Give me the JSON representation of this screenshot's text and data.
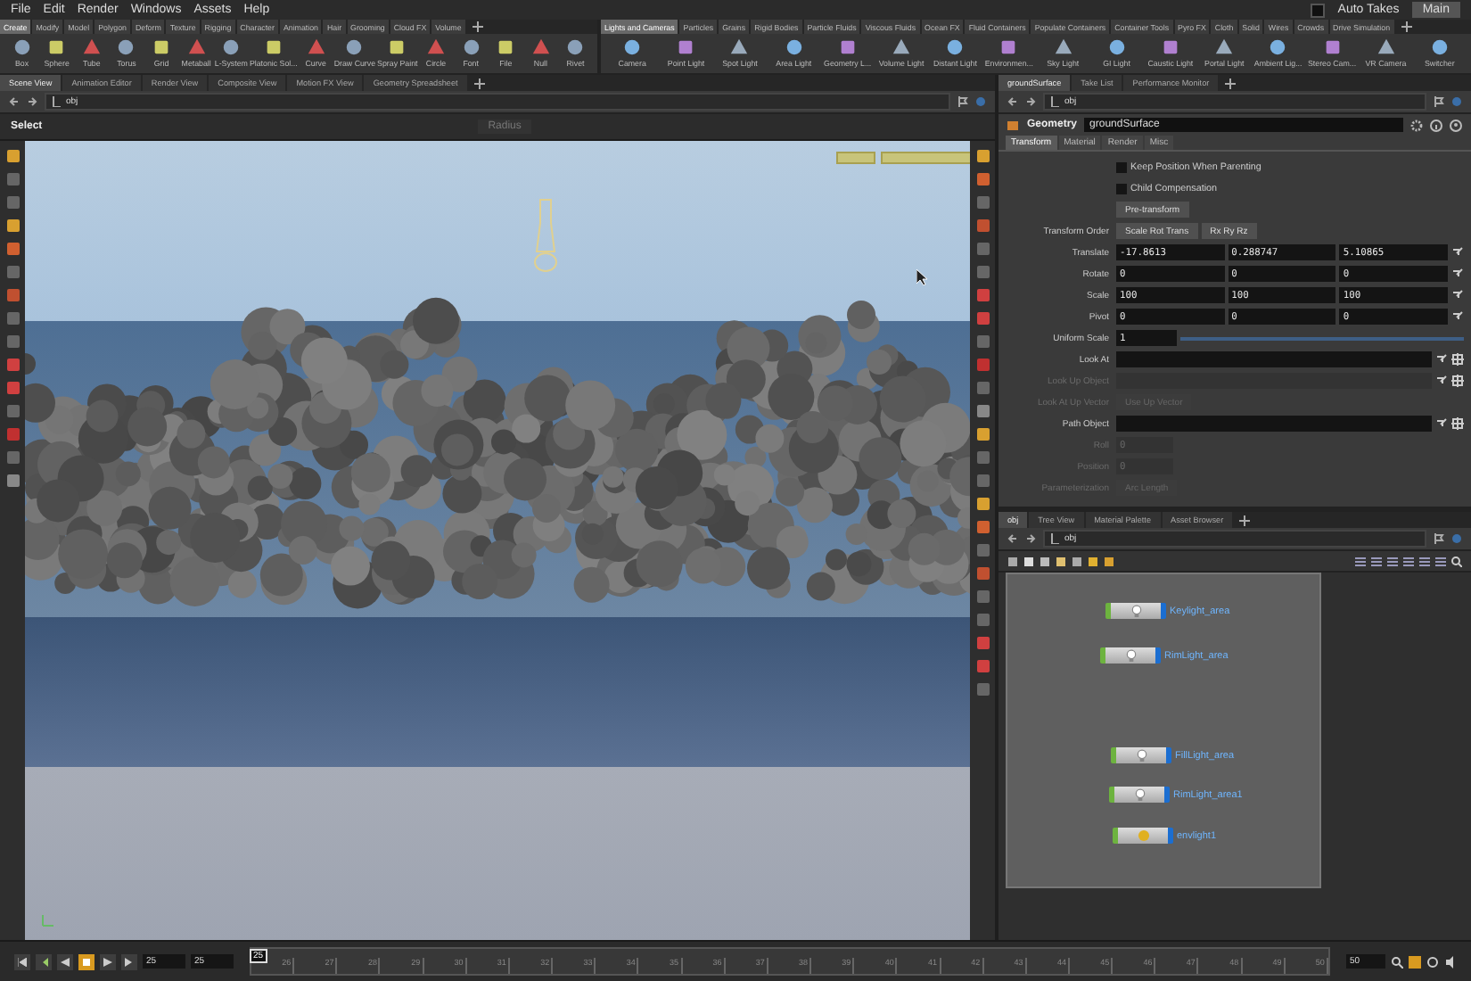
{
  "menu": {
    "items": [
      "File",
      "Edit",
      "Render",
      "Windows",
      "Assets",
      "Help"
    ],
    "auto_takes": {
      "label": "Auto Takes",
      "checked": false
    },
    "take": "Main"
  },
  "shelves": [
    {
      "tabs": [
        {
          "label": "Create",
          "selected": true
        },
        {
          "label": "Modify",
          "selected": false
        },
        {
          "label": "Model",
          "selected": false
        },
        {
          "label": "Polygon",
          "selected": false
        },
        {
          "label": "Deform",
          "selected": false
        },
        {
          "label": "Texture",
          "selected": false
        },
        {
          "label": "Rigging",
          "selected": false
        },
        {
          "label": "Character",
          "selected": false
        },
        {
          "label": "Animation",
          "selected": false
        },
        {
          "label": "Hair",
          "selected": false
        },
        {
          "label": "Grooming",
          "selected": false
        },
        {
          "label": "Cloud FX",
          "selected": false
        },
        {
          "label": "Volume",
          "selected": false
        }
      ],
      "tools": [
        "Box",
        "Sphere",
        "Tube",
        "Torus",
        "Grid",
        "Metaball",
        "L-System",
        "Platonic Sol...",
        "Curve",
        "Draw Curve",
        "Spray Paint",
        "Circle",
        "Font",
        "File",
        "Null",
        "Rivet"
      ]
    },
    {
      "tabs": [
        {
          "label": "Lights and Cameras",
          "selected": true
        },
        {
          "label": "Particles",
          "selected": false
        },
        {
          "label": "Grains",
          "selected": false
        },
        {
          "label": "Rigid Bodies",
          "selected": false
        },
        {
          "label": "Particle Fluids",
          "selected": false
        },
        {
          "label": "Viscous Fluids",
          "selected": false
        },
        {
          "label": "Ocean FX",
          "selected": false
        },
        {
          "label": "Fluid Containers",
          "selected": false
        },
        {
          "label": "Populate Containers",
          "selected": false
        },
        {
          "label": "Container Tools",
          "selected": false
        },
        {
          "label": "Pyro FX",
          "selected": false
        },
        {
          "label": "Cloth",
          "selected": false
        },
        {
          "label": "Solid",
          "selected": false
        },
        {
          "label": "Wires",
          "selected": false
        },
        {
          "label": "Crowds",
          "selected": false
        },
        {
          "label": "Drive Simulation",
          "selected": false
        }
      ],
      "tools": [
        "Camera",
        "Point Light",
        "Spot Light",
        "Area Light",
        "Geometry L...",
        "Volume Light",
        "Distant Light",
        "Environmen...",
        "Sky Light",
        "GI Light",
        "Caustic Light",
        "Portal Light",
        "Ambient Lig...",
        "Stereo Cam...",
        "VR Camera",
        "Switcher"
      ]
    }
  ],
  "scene_pane": {
    "tabs": [
      {
        "label": "Scene View",
        "selected": true
      },
      {
        "label": "Animation Editor",
        "selected": false
      },
      {
        "label": "Render View",
        "selected": false
      },
      {
        "label": "Composite View",
        "selected": false
      },
      {
        "label": "Motion FX View",
        "selected": false
      },
      {
        "label": "Geometry Spreadsheet",
        "selected": false
      }
    ],
    "path": "obj",
    "tool": "Select",
    "radius_label": "Radius"
  },
  "parameters": {
    "tabs": [
      {
        "label": "groundSurface",
        "selected": true
      },
      {
        "label": "Take List",
        "selected": false
      },
      {
        "label": "Performance Monitor",
        "selected": false
      }
    ],
    "path": "obj",
    "node_type": "Geometry",
    "node_name": "groundSurface",
    "param_tabs": [
      {
        "label": "Transform",
        "selected": true
      },
      {
        "label": "Material",
        "selected": false
      },
      {
        "label": "Render",
        "selected": false
      },
      {
        "label": "Misc",
        "selected": false
      }
    ],
    "rows": [
      {
        "kind": "checkbox",
        "text": "Keep Position When Parenting",
        "checked": false
      },
      {
        "kind": "checkbox",
        "text": "Child Compensation",
        "checked": false
      },
      {
        "kind": "menu",
        "values": [
          "Pre-transform"
        ],
        "disabled": false
      },
      {
        "kind": "menu",
        "label": "Transform Order",
        "values": [
          "Scale Rot Trans",
          "Rx Ry Rz"
        ],
        "disabled": false
      },
      {
        "kind": "vector",
        "label": "Translate",
        "values": [
          "-17.8613",
          "0.288747",
          "5.10865"
        ]
      },
      {
        "kind": "vector",
        "label": "Rotate",
        "values": [
          "0",
          "0",
          "0"
        ]
      },
      {
        "kind": "vector",
        "label": "Scale",
        "values": [
          "100",
          "100",
          "100"
        ]
      },
      {
        "kind": "vector",
        "label": "Pivot",
        "values": [
          "0",
          "0",
          "0"
        ]
      },
      {
        "kind": "slider",
        "label": "Uniform Scale",
        "value": "1",
        "level": 1
      },
      {
        "kind": "field",
        "label": "Look At",
        "disabled": false
      },
      {
        "kind": "field",
        "label": "Look Up Object",
        "disabled": true
      },
      {
        "kind": "menu",
        "label": "Look At Up Vector",
        "values": [
          "Use Up Vector"
        ],
        "disabled": true
      },
      {
        "kind": "field",
        "label": "Path Object",
        "disabled": false
      },
      {
        "kind": "short",
        "label": "Roll",
        "value": "0",
        "disabled": true
      },
      {
        "kind": "short",
        "label": "Position",
        "value": "0",
        "disabled": true
      },
      {
        "kind": "menu",
        "label": "Parameterization",
        "values": [
          "Arc Length"
        ],
        "disabled": true
      }
    ]
  },
  "network": {
    "tabs": [
      {
        "label": "obj",
        "selected": true
      },
      {
        "label": "Tree View",
        "selected": false
      },
      {
        "label": "Material Palette",
        "selected": false
      },
      {
        "label": "Asset Browser",
        "selected": false
      }
    ],
    "path": "obj",
    "nodes": [
      {
        "name": "Keylight_area",
        "kind": "area_light"
      },
      {
        "name": "RimLight_area",
        "kind": "area_light"
      },
      {
        "name": "FillLight_area",
        "kind": "area_light"
      },
      {
        "name": "RimLight_area1",
        "kind": "area_light"
      },
      {
        "name": "envlight1",
        "kind": "env_light"
      }
    ]
  },
  "timeline": {
    "buttons": [
      {
        "kind": "first",
        "selected": false
      },
      {
        "kind": "prev_key",
        "selected": false
      },
      {
        "kind": "reverse",
        "selected": false
      },
      {
        "kind": "stop",
        "selected": true
      },
      {
        "kind": "play",
        "selected": false
      },
      {
        "kind": "last",
        "selected": false
      }
    ],
    "start": "25",
    "end": "25",
    "current": "25",
    "ticks": [
      "26",
      "27",
      "28",
      "29",
      "30",
      "31",
      "32",
      "33",
      "34",
      "35",
      "36",
      "37",
      "38",
      "39",
      "40",
      "41",
      "42",
      "43",
      "44",
      "45",
      "46",
      "47",
      "48",
      "49",
      "50"
    ],
    "range_end": "50"
  }
}
